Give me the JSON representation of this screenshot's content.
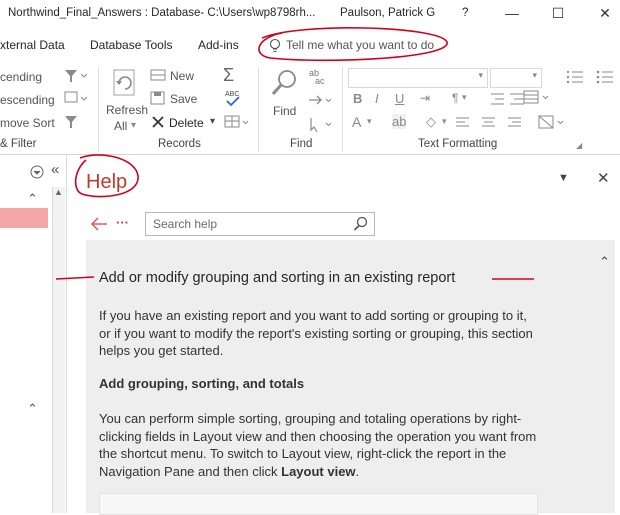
{
  "window": {
    "title": "Northwind_Final_Answers : Database- C:\\Users\\wp8798rh...",
    "user": "Paulson, Patrick G",
    "help_btn": "?",
    "minimize": "—",
    "maximize": "☐",
    "close": "✕"
  },
  "tabs": [
    {
      "label": "xternal Data"
    },
    {
      "label": "Database Tools"
    },
    {
      "label": "Add-ins"
    }
  ],
  "tell_me": {
    "placeholder": "Tell me what you want to do"
  },
  "ribbon": {
    "sort_filter": {
      "ascending": "cending",
      "descending": "escending",
      "remove_sort": "move Sort",
      "group_label": "& Filter"
    },
    "records": {
      "refresh": "Refresh",
      "refresh_all": "All",
      "new": "New",
      "save": "Save",
      "delete": "Delete",
      "group_label": "Records"
    },
    "find": {
      "find": "Find",
      "group_label": "Find"
    },
    "text_formatting": {
      "group_label": "Text Formatting"
    }
  },
  "help": {
    "title": "Help",
    "dots": "···",
    "search_placeholder": "Search help",
    "article": {
      "heading": "Add or modify grouping and sorting in an existing report",
      "intro": "If you have an existing report and you want to add sorting or grouping to it, or if you want to modify the report's existing sorting or grouping, this section helps you get started.",
      "subheading": "Add grouping, sorting, and totals",
      "body_1": "You can perform simple sorting, grouping and totaling operations by right-clicking fields in Layout view and then choosing the operation you want from the shortcut menu. To switch to Layout view, right-click the report in the Navigation Pane and then click ",
      "body_bold": "Layout view",
      "body_end": "."
    }
  },
  "colors": {
    "accent_red": "#d0021b",
    "nav_selected": "#f4a7a7",
    "help_bg": "#eeeeee"
  }
}
